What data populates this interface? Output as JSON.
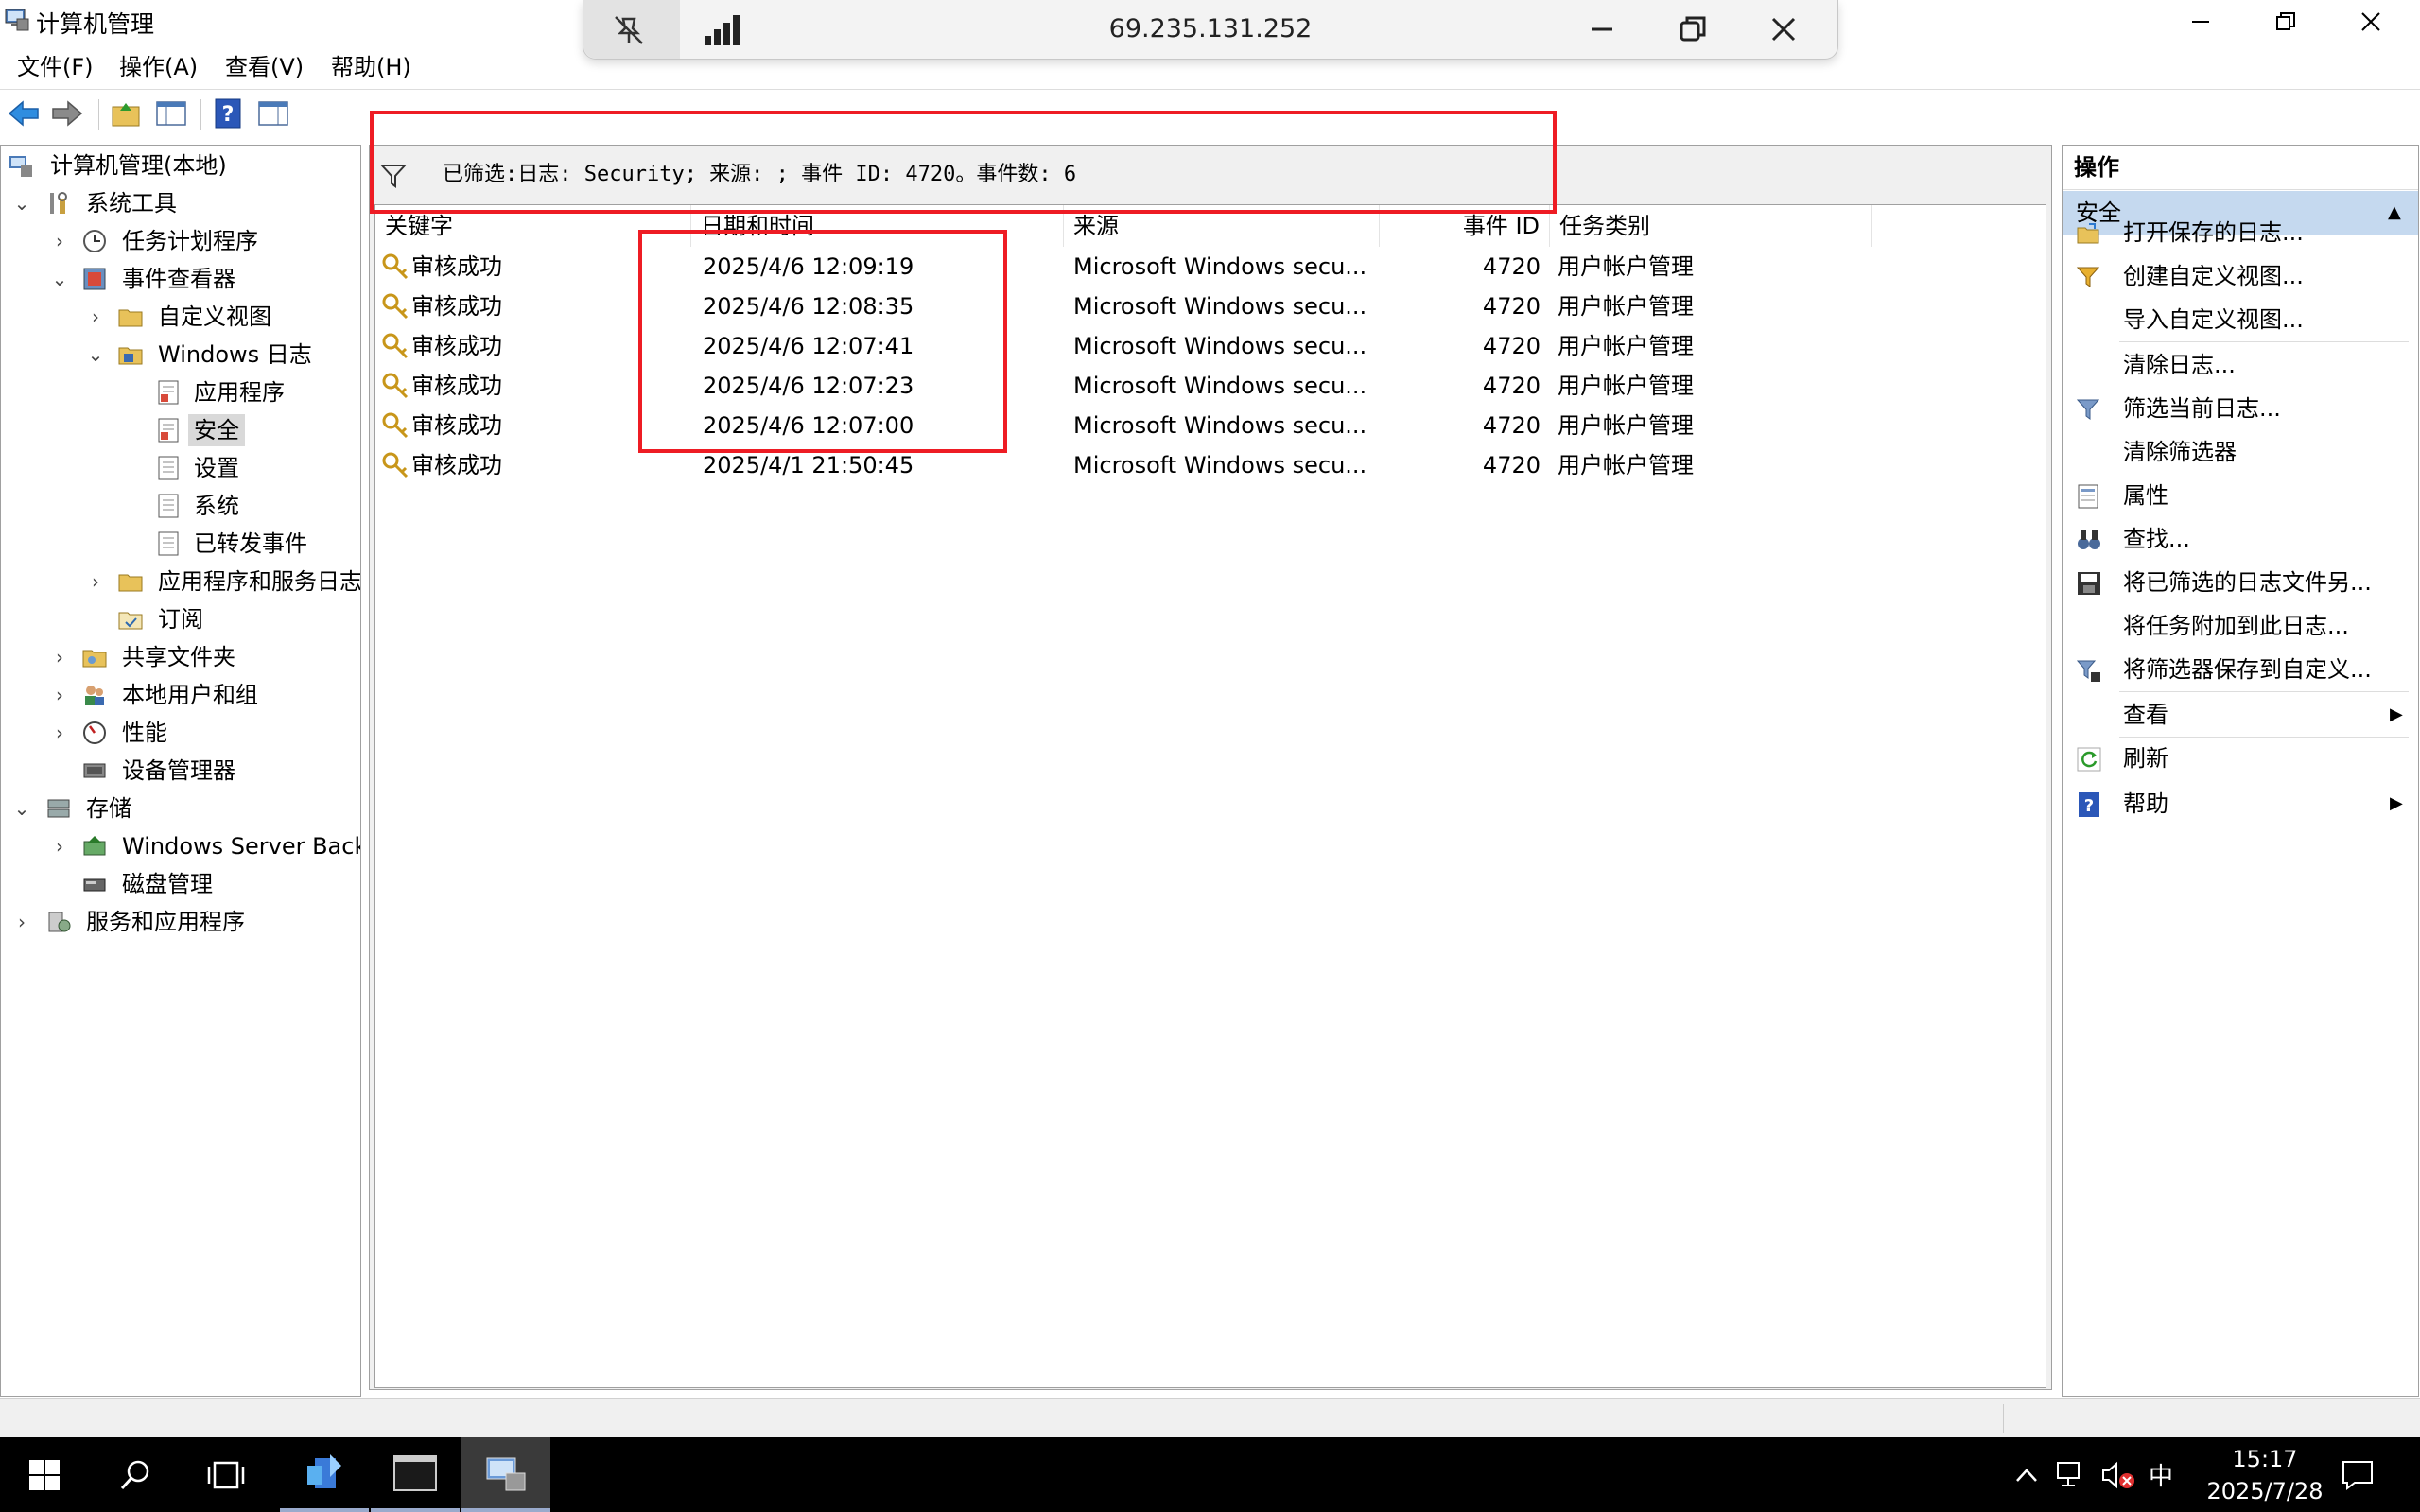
{
  "window": {
    "title": "计算机管理"
  },
  "remote_bar": {
    "ip": "69.235.131.252"
  },
  "menu": [
    {
      "label": "文件(F)"
    },
    {
      "label": "操作(A)"
    },
    {
      "label": "查看(V)"
    },
    {
      "label": "帮助(H)"
    }
  ],
  "tree": {
    "root": "计算机管理(本地)",
    "system_tools": "系统工具",
    "task_scheduler": "任务计划程序",
    "event_viewer": "事件查看器",
    "custom_views": "自定义视图",
    "windows_logs": "Windows 日志",
    "application": "应用程序",
    "security": "安全",
    "setup": "设置",
    "system": "系统",
    "forwarded": "已转发事件",
    "app_service_logs": "应用程序和服务日志",
    "subscriptions": "订阅",
    "shared_folders": "共享文件夹",
    "local_users": "本地用户和组",
    "performance": "性能",
    "device_manager": "设备管理器",
    "storage": "存储",
    "wsb": "Windows Server Back",
    "disk_mgmt": "磁盘管理",
    "services_apps": "服务和应用程序"
  },
  "filter": {
    "text": "已筛选:日志: Security; 来源: ; 事件 ID: 4720。事件数: 6"
  },
  "columns": {
    "keyword": "关键字",
    "datetime": "日期和时间",
    "source": "来源",
    "event_id": "事件 ID",
    "category": "任务类别"
  },
  "events": [
    {
      "keyword": "审核成功",
      "datetime": "2025/4/6 12:09:19",
      "source": "Microsoft Windows secu...",
      "event_id": "4720",
      "category": "用户帐户管理"
    },
    {
      "keyword": "审核成功",
      "datetime": "2025/4/6 12:08:35",
      "source": "Microsoft Windows secu...",
      "event_id": "4720",
      "category": "用户帐户管理"
    },
    {
      "keyword": "审核成功",
      "datetime": "2025/4/6 12:07:41",
      "source": "Microsoft Windows secu...",
      "event_id": "4720",
      "category": "用户帐户管理"
    },
    {
      "keyword": "审核成功",
      "datetime": "2025/4/6 12:07:23",
      "source": "Microsoft Windows secu...",
      "event_id": "4720",
      "category": "用户帐户管理"
    },
    {
      "keyword": "审核成功",
      "datetime": "2025/4/6 12:07:00",
      "source": "Microsoft Windows secu...",
      "event_id": "4720",
      "category": "用户帐户管理"
    },
    {
      "keyword": "审核成功",
      "datetime": "2025/4/1 21:50:45",
      "source": "Microsoft Windows secu...",
      "event_id": "4720",
      "category": "用户帐户管理"
    }
  ],
  "actions": {
    "header": "操作",
    "section": "安全",
    "items": [
      {
        "label": "打开保存的日志..."
      },
      {
        "label": "创建自定义视图..."
      },
      {
        "label": "导入自定义视图..."
      },
      {
        "label": "清除日志..."
      },
      {
        "label": "筛选当前日志..."
      },
      {
        "label": "清除筛选器"
      },
      {
        "label": "属性"
      },
      {
        "label": "查找..."
      },
      {
        "label": "将已筛选的日志文件另..."
      },
      {
        "label": "将任务附加到此日志..."
      },
      {
        "label": "将筛选器保存到自定义..."
      },
      {
        "label": "查看"
      },
      {
        "label": "刷新"
      },
      {
        "label": "帮助"
      }
    ]
  },
  "tray": {
    "ime": "中",
    "time": "15:17",
    "date": "2025/7/28"
  },
  "colors": {
    "selection": "#cce8ff",
    "action_section": "#c5d9ef",
    "highlight_box": "#ee1c24",
    "taskbar": "#000000"
  }
}
